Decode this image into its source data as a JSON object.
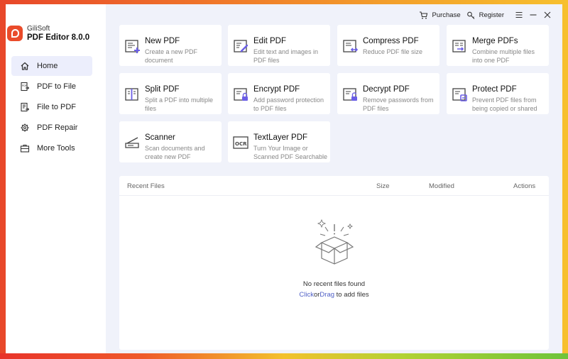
{
  "brand": {
    "company": "GiliSoft",
    "product": "PDF Editor 8.0.0"
  },
  "nav": {
    "items": [
      {
        "label": "Home",
        "icon": "home-icon"
      },
      {
        "label": "PDF to File",
        "icon": "pdf-to-file-icon"
      },
      {
        "label": "File to  PDF",
        "icon": "file-to-pdf-icon"
      },
      {
        "label": "PDF Repair",
        "icon": "repair-gear-icon"
      },
      {
        "label": "More Tools",
        "icon": "more-tools-icon"
      }
    ],
    "active": "Home"
  },
  "topbar": {
    "purchase": "Purchase",
    "register": "Register"
  },
  "tools": [
    {
      "title": "New PDF",
      "desc1": "Create a new PDF",
      "desc2": "document",
      "icon": "new-pdf-icon"
    },
    {
      "title": "Edit PDF",
      "desc1": "Edit text and images in",
      "desc2": "PDF files",
      "icon": "edit-pdf-icon"
    },
    {
      "title": "Compress PDF",
      "desc1": "Reduce PDF file size",
      "desc2": "",
      "icon": "compress-pdf-icon"
    },
    {
      "title": "Merge PDFs",
      "desc1": "Combine multiple files",
      "desc2": "into one PDF",
      "icon": "merge-pdf-icon"
    },
    {
      "title": "Split PDF",
      "desc1": "Split a PDF into multiple",
      "desc2": "files",
      "icon": "split-pdf-icon"
    },
    {
      "title": "Encrypt PDF",
      "desc1": "Add password protection",
      "desc2": "to PDF files",
      "icon": "encrypt-pdf-icon"
    },
    {
      "title": "Decrypt PDF",
      "desc1": "Remove passwords from",
      "desc2": "PDF files",
      "icon": "decrypt-pdf-icon"
    },
    {
      "title": "Protect PDF",
      "desc1": "Prevent PDF files from",
      "desc2": "being copied or shared",
      "icon": "protect-pdf-icon"
    },
    {
      "title": "Scanner",
      "desc1": "Scan documents and",
      "desc2": "create new PDF",
      "icon": "scanner-icon"
    },
    {
      "title": "TextLayer PDF",
      "desc1": "Turn Your Image or",
      "desc2": "Scanned PDF Searchable",
      "icon": "ocr-icon"
    }
  ],
  "recent": {
    "columns": {
      "name": "Recent Files",
      "size": "Size",
      "modified": "Modified",
      "actions": "Actions"
    },
    "empty_text": "No recent files found",
    "hint_click": "Click",
    "hint_or": "or",
    "hint_drag": "Drag",
    "hint_rest": "to add files"
  },
  "colors": {
    "accent": "#6b5ee6",
    "brand": "#ea4b2a",
    "link": "#4f5fc6"
  }
}
